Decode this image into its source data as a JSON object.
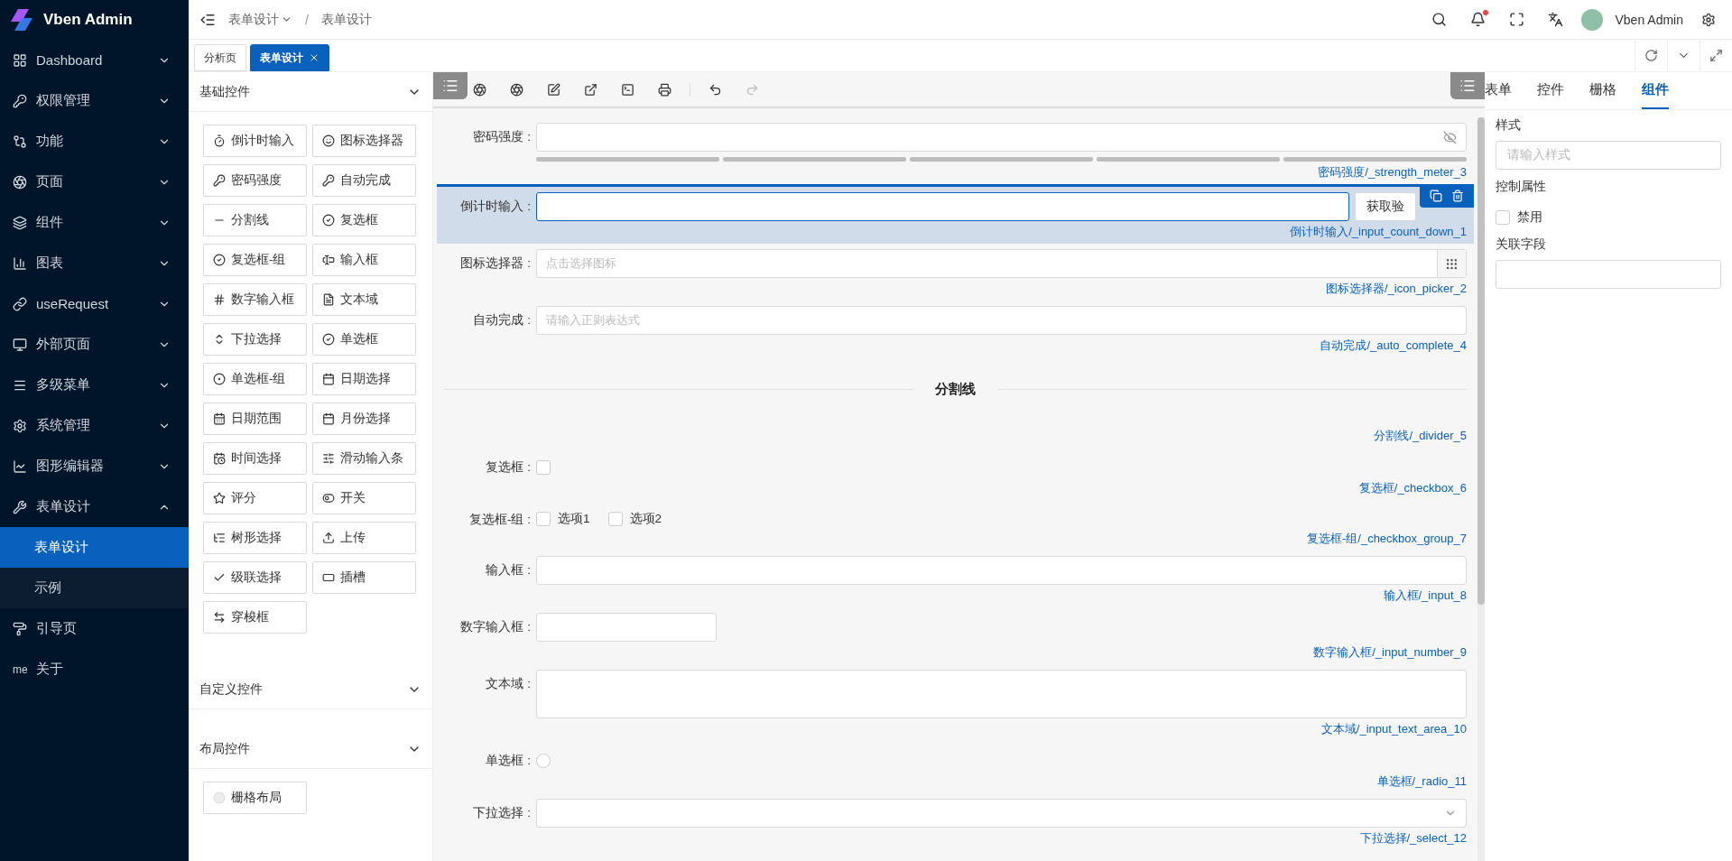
{
  "app": {
    "name": "Vben Admin"
  },
  "sidebar": {
    "items": [
      {
        "label": "Dashboard",
        "expanded": false
      },
      {
        "label": "权限管理",
        "expanded": false
      },
      {
        "label": "功能",
        "expanded": false
      },
      {
        "label": "页面",
        "expanded": false
      },
      {
        "label": "组件",
        "expanded": false
      },
      {
        "label": "图表",
        "expanded": false
      },
      {
        "label": "useRequest",
        "expanded": false
      },
      {
        "label": "外部页面",
        "expanded": false
      },
      {
        "label": "多级菜单",
        "expanded": false
      },
      {
        "label": "系统管理",
        "expanded": false
      },
      {
        "label": "图形编辑器",
        "expanded": false
      },
      {
        "label": "表单设计",
        "expanded": true,
        "children": [
          {
            "label": "表单设计",
            "selected": true
          },
          {
            "label": "示例",
            "selected": false
          }
        ]
      },
      {
        "label": "引导页"
      },
      {
        "label": "关于",
        "icon_text": "me"
      }
    ]
  },
  "header": {
    "breadcrumb": [
      "表单设计",
      "表单设计"
    ],
    "separator": "/",
    "user": "Vben Admin",
    "notification_dot": true
  },
  "tabs": [
    {
      "label": "分析页",
      "selected": false,
      "closable": false
    },
    {
      "label": "表单设计",
      "selected": true,
      "closable": true
    }
  ],
  "widget_panel": {
    "sections": [
      {
        "title": "基础控件",
        "widgets": [
          "倒计时输入",
          "图标选择器",
          "密码强度",
          "自动完成",
          "分割线",
          "复选框",
          "复选框-组",
          "输入框",
          "数字输入框",
          "文本域",
          "下拉选择",
          "单选框",
          "单选框-组",
          "日期选择",
          "日期范围",
          "月份选择",
          "时间选择",
          "滑动输入条",
          "评分",
          "开关",
          "树形选择",
          "上传",
          "级联选择",
          "插槽",
          "穿梭框"
        ]
      },
      {
        "title": "自定义控件"
      },
      {
        "title": "布局控件",
        "widgets": [
          "栅格布局"
        ]
      }
    ]
  },
  "form": {
    "items": [
      {
        "kind": "password",
        "label": "密码强度 :",
        "caption": "密码强度/_strength_meter_3",
        "selected": false
      },
      {
        "kind": "countdown",
        "label": "倒计时输入 :",
        "button": "获取验",
        "caption": "倒计时输入/_input_count_down_1",
        "selected": true
      },
      {
        "kind": "icon_picker",
        "label": "图标选择器 :",
        "placeholder": "点击选择图标",
        "caption": "图标选择器/_icon_picker_2",
        "selected": false
      },
      {
        "kind": "input",
        "label": "自动完成 :",
        "placeholder": "请输入正则表达式",
        "caption": "自动完成/_auto_complete_4",
        "selected": false
      },
      {
        "kind": "divider",
        "text": "分割线",
        "caption": "分割线/_divider_5",
        "selected": false
      },
      {
        "kind": "checkbox",
        "label": "复选框 :",
        "checked": false,
        "caption": "复选框/_checkbox_6",
        "selected": false
      },
      {
        "kind": "checkbox_group",
        "label": "复选框-组 :",
        "options": [
          {
            "label": "选项1",
            "checked": false
          },
          {
            "label": "选项2",
            "checked": false
          }
        ],
        "caption": "复选框-组/_checkbox_group_7",
        "selected": false
      },
      {
        "kind": "input",
        "label": "输入框 :",
        "caption": "输入框/_input_8",
        "selected": false
      },
      {
        "kind": "number",
        "label": "数字输入框 :",
        "caption": "数字输入框/_input_number_9",
        "selected": false
      },
      {
        "kind": "textarea",
        "label": "文本域 :",
        "caption": "文本域/_input_text_area_10",
        "selected": false
      },
      {
        "kind": "radio",
        "label": "单选框 :",
        "checked": false,
        "caption": "单选框/_radio_11",
        "selected": false
      },
      {
        "kind": "select",
        "label": "下拉选择 :",
        "caption": "下拉选择/_select_12",
        "selected": false
      }
    ]
  },
  "properties_panel": {
    "tabs": [
      {
        "label": "表单",
        "selected": false
      },
      {
        "label": "控件",
        "selected": false
      },
      {
        "label": "栅格",
        "selected": false
      },
      {
        "label": "组件",
        "selected": true
      }
    ],
    "fields": [
      {
        "kind": "input",
        "label": "样式",
        "placeholder": "请输入样式"
      },
      {
        "kind": "checkbox",
        "label": "控制属性",
        "option": "禁用",
        "checked": false
      },
      {
        "kind": "input",
        "label": "关联字段"
      }
    ]
  }
}
